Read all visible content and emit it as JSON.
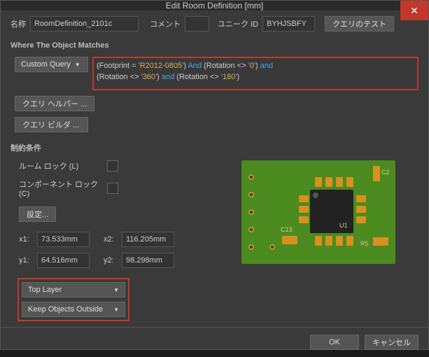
{
  "title": "Edit Room Definition [mm]",
  "header": {
    "name_label": "名称",
    "name_value": "RoomDefinition_2101c",
    "comment_label": "コメント",
    "comment_value": "",
    "uniqueid_label": "ユニーク ID",
    "uniqueid_value": "BYHJSBFY",
    "test_query_btn": "クエリのテスト"
  },
  "match_section": "Where The Object Matches",
  "custom_query_label": "Custom Query",
  "query_tokens": [
    {
      "t": "(Footprint = "
    },
    {
      "t": "'R2012-0805'",
      "c": "kw-str"
    },
    {
      "t": ") "
    },
    {
      "t": "And",
      "c": "kw-and"
    },
    {
      "t": " (Rotation <> "
    },
    {
      "t": "'0'",
      "c": "kw-str"
    },
    {
      "t": ") "
    },
    {
      "t": "and",
      "c": "kw-and"
    },
    {
      "t": " (Rotation <> "
    },
    {
      "t": "'360'",
      "c": "kw-str"
    },
    {
      "t": ") "
    },
    {
      "t": "and",
      "c": "kw-and"
    },
    {
      "t": " (Rotation <> "
    },
    {
      "t": "'180'",
      "c": "kw-str"
    },
    {
      "t": ")"
    }
  ],
  "helper_btn": "クエリ ヘルパー ...",
  "builder_btn": "クエリ ビルダ ...",
  "constraints_section": "制約条件",
  "room_lock_label": "ルーム ロック (L)",
  "comp_lock_label": "コンポーネント ロック (C)",
  "settings_btn": "設定...",
  "coords": {
    "x1_label": "x1:",
    "x1": "73.533mm",
    "x2_label": "x2:",
    "x2": "116.205mm",
    "y1_label": "y1:",
    "y1": "64.516mm",
    "y2_label": "y2:",
    "y2": "98.298mm"
  },
  "layer_dd": "Top Layer",
  "keep_dd": "Keep Objects Outside",
  "pcb_labels": {
    "u1": "U1",
    "c2": "C2",
    "r5": "R5",
    "c13": "C13"
  },
  "footer": {
    "ok": "OK",
    "cancel": "キャンセル"
  }
}
